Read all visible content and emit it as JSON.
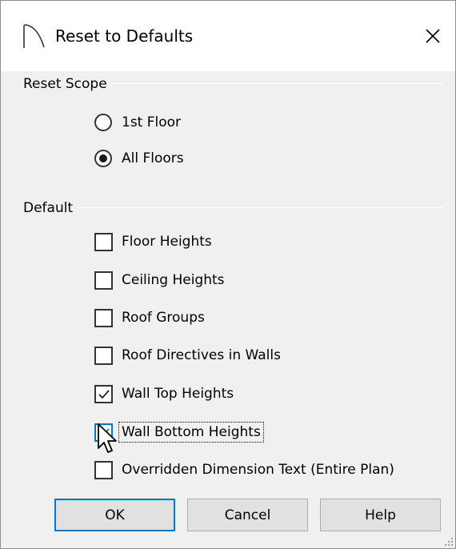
{
  "dialog": {
    "title": "Reset to Defaults",
    "icons": {
      "app": "arch-icon",
      "close": "close-icon"
    }
  },
  "reset_scope": {
    "label": "Reset Scope",
    "options": [
      {
        "label": "1st Floor",
        "selected": false
      },
      {
        "label": "All Floors",
        "selected": true
      }
    ]
  },
  "default": {
    "label": "Default",
    "items": [
      {
        "label": "Floor Heights",
        "checked": false
      },
      {
        "label": "Ceiling Heights",
        "checked": false
      },
      {
        "label": "Roof Groups",
        "checked": false
      },
      {
        "label": "Roof Directives in Walls",
        "checked": false
      },
      {
        "label": "Wall Top Heights",
        "checked": true
      },
      {
        "label": "Wall Bottom Heights",
        "checked": true,
        "focused": true
      },
      {
        "label": "Overridden Dimension Text (Entire Plan)",
        "checked": false
      }
    ]
  },
  "buttons": {
    "ok": "OK",
    "cancel": "Cancel",
    "help": "Help"
  },
  "colors": {
    "dialog_bg": "#f0f0f0",
    "title_bg": "#ffffff",
    "accent": "#0078d7"
  }
}
